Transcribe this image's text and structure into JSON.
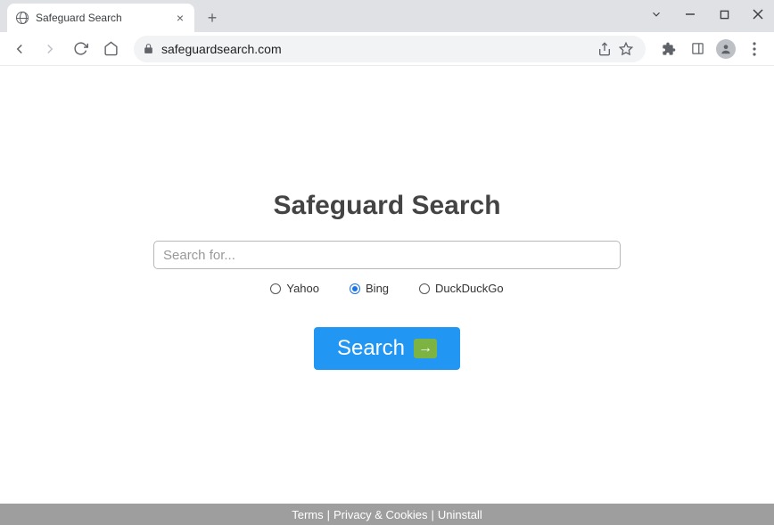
{
  "browser": {
    "tab_title": "Safeguard Search",
    "url": "safeguardsearch.com"
  },
  "page": {
    "brand": "Safeguard Search",
    "search_placeholder": "Search for...",
    "engines": [
      {
        "id": "yahoo",
        "label": "Yahoo",
        "selected": false
      },
      {
        "id": "bing",
        "label": "Bing",
        "selected": true
      },
      {
        "id": "ddg",
        "label": "DuckDuckGo",
        "selected": false
      }
    ],
    "search_button": "Search"
  },
  "footer": {
    "terms": "Terms",
    "privacy": "Privacy & Cookies",
    "uninstall": "Uninstall",
    "sep": " | "
  }
}
